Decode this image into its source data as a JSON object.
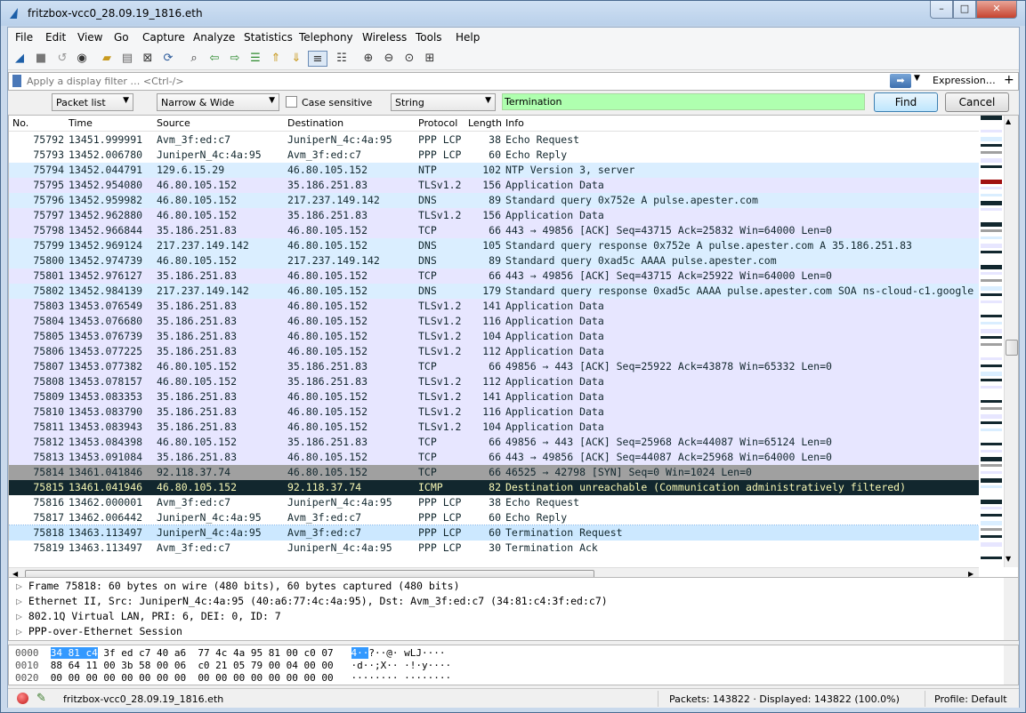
{
  "window": {
    "title": "fritzbox-vcc0_28.09.19_1816.eth",
    "min": "–",
    "max": "□",
    "close": "✕"
  },
  "menu": [
    "File",
    "Edit",
    "View",
    "Go",
    "Capture",
    "Analyze",
    "Statistics",
    "Telephony",
    "Wireless",
    "Tools",
    "Help"
  ],
  "filter": {
    "placeholder": "Apply a display filter … <Ctrl-/>",
    "expression_label": "Expression…",
    "plus_label": "+"
  },
  "find": {
    "search_in": "Packet list",
    "char_width": "Narrow & Wide",
    "case_sensitive_label": "Case sensitive",
    "search_type": "String",
    "value": "Termination",
    "find_label": "Find",
    "cancel_label": "Cancel"
  },
  "columns": [
    "No.",
    "Time",
    "Source",
    "Destination",
    "Protocol",
    "Length",
    "Info"
  ],
  "packets": [
    {
      "no": "75792",
      "time": "13451.999991",
      "src": "Avm_3f:ed:c7",
      "dst": "JuniperN_4c:4a:95",
      "proto": "PPP LCP",
      "len": "38",
      "info": "Echo Request",
      "style": "ppp"
    },
    {
      "no": "75793",
      "time": "13452.006780",
      "src": "JuniperN_4c:4a:95",
      "dst": "Avm_3f:ed:c7",
      "proto": "PPP LCP",
      "len": "60",
      "info": "Echo Reply",
      "style": "ppp"
    },
    {
      "no": "75794",
      "time": "13452.044791",
      "src": "129.6.15.29",
      "dst": "46.80.105.152",
      "proto": "NTP",
      "len": "102",
      "info": "NTP Version 3, server",
      "style": "udp"
    },
    {
      "no": "75795",
      "time": "13452.954080",
      "src": "46.80.105.152",
      "dst": "35.186.251.83",
      "proto": "TLSv1.2",
      "len": "156",
      "info": "Application Data",
      "style": "tcp"
    },
    {
      "no": "75796",
      "time": "13452.959982",
      "src": "46.80.105.152",
      "dst": "217.237.149.142",
      "proto": "DNS",
      "len": "89",
      "info": "Standard query 0x752e A pulse.apester.com",
      "style": "udp"
    },
    {
      "no": "75797",
      "time": "13452.962880",
      "src": "46.80.105.152",
      "dst": "35.186.251.83",
      "proto": "TLSv1.2",
      "len": "156",
      "info": "Application Data",
      "style": "tcp"
    },
    {
      "no": "75798",
      "time": "13452.966844",
      "src": "35.186.251.83",
      "dst": "46.80.105.152",
      "proto": "TCP",
      "len": "66",
      "info": "443 → 49856 [ACK] Seq=43715 Ack=25832 Win=64000 Len=0",
      "style": "tcp"
    },
    {
      "no": "75799",
      "time": "13452.969124",
      "src": "217.237.149.142",
      "dst": "46.80.105.152",
      "proto": "DNS",
      "len": "105",
      "info": "Standard query response 0x752e A pulse.apester.com A 35.186.251.83",
      "style": "udp"
    },
    {
      "no": "75800",
      "time": "13452.974739",
      "src": "46.80.105.152",
      "dst": "217.237.149.142",
      "proto": "DNS",
      "len": "89",
      "info": "Standard query 0xad5c AAAA pulse.apester.com",
      "style": "udp"
    },
    {
      "no": "75801",
      "time": "13452.976127",
      "src": "35.186.251.83",
      "dst": "46.80.105.152",
      "proto": "TCP",
      "len": "66",
      "info": "443 → 49856 [ACK] Seq=43715 Ack=25922 Win=64000 Len=0",
      "style": "tcp"
    },
    {
      "no": "75802",
      "time": "13452.984139",
      "src": "217.237.149.142",
      "dst": "46.80.105.152",
      "proto": "DNS",
      "len": "179",
      "info": "Standard query response 0xad5c AAAA pulse.apester.com SOA ns-cloud-c1.google",
      "style": "udp"
    },
    {
      "no": "75803",
      "time": "13453.076549",
      "src": "35.186.251.83",
      "dst": "46.80.105.152",
      "proto": "TLSv1.2",
      "len": "141",
      "info": "Application Data",
      "style": "tcp"
    },
    {
      "no": "75804",
      "time": "13453.076680",
      "src": "35.186.251.83",
      "dst": "46.80.105.152",
      "proto": "TLSv1.2",
      "len": "116",
      "info": "Application Data",
      "style": "tcp"
    },
    {
      "no": "75805",
      "time": "13453.076739",
      "src": "35.186.251.83",
      "dst": "46.80.105.152",
      "proto": "TLSv1.2",
      "len": "104",
      "info": "Application Data",
      "style": "tcp"
    },
    {
      "no": "75806",
      "time": "13453.077225",
      "src": "35.186.251.83",
      "dst": "46.80.105.152",
      "proto": "TLSv1.2",
      "len": "112",
      "info": "Application Data",
      "style": "tcp"
    },
    {
      "no": "75807",
      "time": "13453.077382",
      "src": "46.80.105.152",
      "dst": "35.186.251.83",
      "proto": "TCP",
      "len": "66",
      "info": "49856 → 443 [ACK] Seq=25922 Ack=43878 Win=65332 Len=0",
      "style": "tcp"
    },
    {
      "no": "75808",
      "time": "13453.078157",
      "src": "46.80.105.152",
      "dst": "35.186.251.83",
      "proto": "TLSv1.2",
      "len": "112",
      "info": "Application Data",
      "style": "tcp"
    },
    {
      "no": "75809",
      "time": "13453.083353",
      "src": "35.186.251.83",
      "dst": "46.80.105.152",
      "proto": "TLSv1.2",
      "len": "141",
      "info": "Application Data",
      "style": "tcp"
    },
    {
      "no": "75810",
      "time": "13453.083790",
      "src": "35.186.251.83",
      "dst": "46.80.105.152",
      "proto": "TLSv1.2",
      "len": "116",
      "info": "Application Data",
      "style": "tcp"
    },
    {
      "no": "75811",
      "time": "13453.083943",
      "src": "35.186.251.83",
      "dst": "46.80.105.152",
      "proto": "TLSv1.2",
      "len": "104",
      "info": "Application Data",
      "style": "tcp"
    },
    {
      "no": "75812",
      "time": "13453.084398",
      "src": "46.80.105.152",
      "dst": "35.186.251.83",
      "proto": "TCP",
      "len": "66",
      "info": "49856 → 443 [ACK] Seq=25968 Ack=44087 Win=65124 Len=0",
      "style": "tcp"
    },
    {
      "no": "75813",
      "time": "13453.091084",
      "src": "35.186.251.83",
      "dst": "46.80.105.152",
      "proto": "TCP",
      "len": "66",
      "info": "443 → 49856 [ACK] Seq=44087 Ack=25968 Win=64000 Len=0",
      "style": "tcp"
    },
    {
      "no": "75814",
      "time": "13461.041846",
      "src": "92.118.37.74",
      "dst": "46.80.105.152",
      "proto": "TCP",
      "len": "66",
      "info": "46525 → 42798 [SYN] Seq=0 Win=1024 Len=0",
      "style": "syn"
    },
    {
      "no": "75815",
      "time": "13461.041946",
      "src": "46.80.105.152",
      "dst": "92.118.37.74",
      "proto": "ICMP",
      "len": "82",
      "info": "Destination unreachable (Communication administratively filtered)",
      "style": "icmp"
    },
    {
      "no": "75816",
      "time": "13462.000001",
      "src": "Avm_3f:ed:c7",
      "dst": "JuniperN_4c:4a:95",
      "proto": "PPP LCP",
      "len": "38",
      "info": "Echo Request",
      "style": "ppp"
    },
    {
      "no": "75817",
      "time": "13462.006442",
      "src": "JuniperN_4c:4a:95",
      "dst": "Avm_3f:ed:c7",
      "proto": "PPP LCP",
      "len": "60",
      "info": "Echo Reply",
      "style": "ppp"
    },
    {
      "no": "75818",
      "time": "13463.113497",
      "src": "JuniperN_4c:4a:95",
      "dst": "Avm_3f:ed:c7",
      "proto": "PPP LCP",
      "len": "60",
      "info": "Termination Request",
      "style": "selected"
    },
    {
      "no": "75819",
      "time": "13463.113497",
      "src": "Avm_3f:ed:c7",
      "dst": "JuniperN_4c:4a:95",
      "proto": "PPP LCP",
      "len": "30",
      "info": "Termination Ack",
      "style": "ppp"
    }
  ],
  "row_styles": {
    "ppp": {
      "bg": "#ffffff",
      "fg": "#12272e"
    },
    "udp": {
      "bg": "#daeeff",
      "fg": "#12272e"
    },
    "tcp": {
      "bg": "#e7e6ff",
      "fg": "#12272e"
    },
    "syn": {
      "bg": "#a0a0a0",
      "fg": "#12272e"
    },
    "icmp": {
      "bg": "#12272e",
      "fg": "#f7f7b4"
    },
    "selected": {
      "bg": "#cce8ff",
      "fg": "#12272e"
    }
  },
  "details": [
    "Frame 75818: 60 bytes on wire (480 bits), 60 bytes captured (480 bits)",
    "Ethernet II, Src: JuniperN_4c:4a:95 (40:a6:77:4c:4a:95), Dst: Avm_3f:ed:c7 (34:81:c4:3f:ed:c7)",
    "802.1Q Virtual LAN, PRI: 6, DEI: 0, ID: 7",
    "PPP-over-Ethernet Session"
  ],
  "hex": [
    {
      "off": "0000",
      "sel": "34 81 c4",
      "rest": " 3f ed c7 40 a6  77 4c 4a 95 81 00 c0 07",
      "asel": "4··",
      "arest": "?··@· wLJ····"
    },
    {
      "off": "0010",
      "sel": "",
      "rest": "88 64 11 00 3b 58 00 06  c0 21 05 79 00 04 00 00",
      "asel": "",
      "arest": "·d··;X·· ·!·y····"
    },
    {
      "off": "0020",
      "sel": "",
      "rest": "00 00 00 00 00 00 00 00  00 00 00 00 00 00 00 00",
      "asel": "",
      "arest": "········ ········"
    }
  ],
  "status": {
    "file": "fritzbox-vcc0_28.09.19_1816.eth",
    "packets": "Packets: 143822 · Displayed: 143822 (100.0%)",
    "profile": "Profile: Default"
  }
}
